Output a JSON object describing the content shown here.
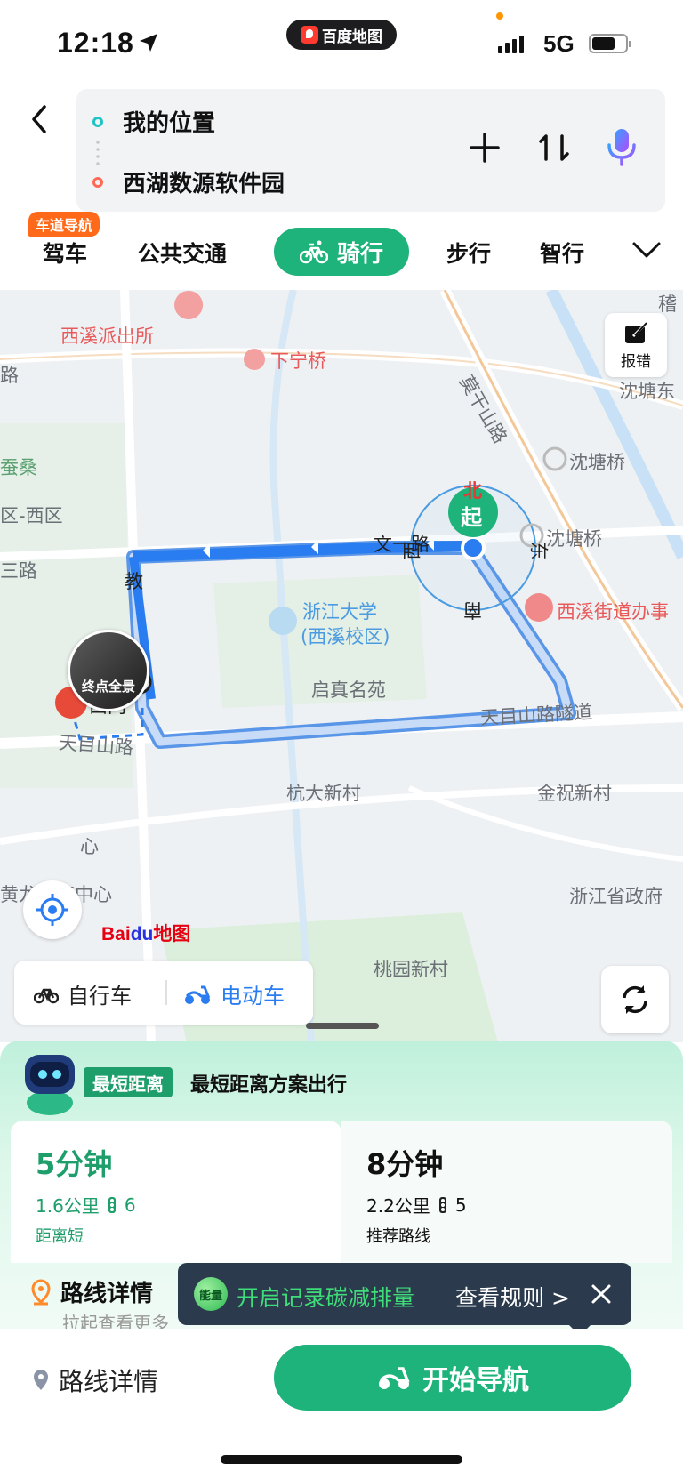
{
  "status_bar": {
    "time": "12:18",
    "app_name": "百度地图",
    "network": "5G",
    "battery_level": 0.7
  },
  "route": {
    "from": "我的位置",
    "to": "西湖数源软件园"
  },
  "header_icons": [
    "add-icon",
    "swap-icon",
    "microphone-icon"
  ],
  "tabs": {
    "lane_badge": "车道导航",
    "items": [
      "驾车",
      "公共交通",
      "骑行",
      "步行",
      "智行"
    ],
    "active": "骑行"
  },
  "map": {
    "labels": {
      "xixi_police": "西溪派出所",
      "xianingqiao": "下宁桥",
      "mogan_road": "莫干山路",
      "shentangdong": "沈塘东",
      "shentangqiao1": "沈塘桥",
      "shentangqiao2": "沈塘桥",
      "wenyi_road": "文一路",
      "zju": "浙江大学",
      "zju_campus": "(西溪校区)",
      "xixi_office": "西溪街道办事",
      "qizhen": "启真名苑",
      "tianmu_tunnel": "天目山路隧道",
      "tianmu_road": "天目山路",
      "hangda_village": "杭大新村",
      "jinzhu_village": "金祝新村",
      "zj_gov": "浙江省政府",
      "taoyuan": "桃园新村",
      "west_gate": "西门",
      "jiao": "教",
      "cansang": "蚕桑",
      "district_west": "区-西区",
      "sanlu": "三路",
      "lu": "路",
      "huanglong": "黄龙体育中心",
      "xin": "心",
      "ji": "稽",
      "compass_n": "北",
      "compass_e": "东",
      "compass_s": "南",
      "compass_w": "西",
      "start_marker": "起"
    },
    "end_view_label": "终点全景",
    "report_label": "报错",
    "logo_text": "Bai",
    "logo_du": "du",
    "logo_suffix": "地图"
  },
  "vehicle": {
    "bike": "自行车",
    "ebike": "电动车",
    "selected": "电动车"
  },
  "sheet": {
    "badge": "最短距离",
    "title": "最短距离方案出行",
    "options": [
      {
        "time": "5分钟",
        "distance": "1.6公里",
        "lights": "6",
        "tag": "距离短",
        "selected": true
      },
      {
        "time": "8分钟",
        "distance": "2.2公里",
        "lights": "5",
        "tag": "推荐路线",
        "selected": false
      }
    ],
    "detail_title": "路线详情",
    "detail_hint": "拉起查看更多",
    "toast": {
      "energy": "能量",
      "text": "开启记录碳减排量",
      "rules": "查看规则 >"
    }
  },
  "action_bar": {
    "detail": "路线详情",
    "start": "开始导航"
  },
  "colors": {
    "brand_green": "#1db37a",
    "route_blue": "#2a7df0",
    "toast_bg": "#2b3a4c"
  }
}
